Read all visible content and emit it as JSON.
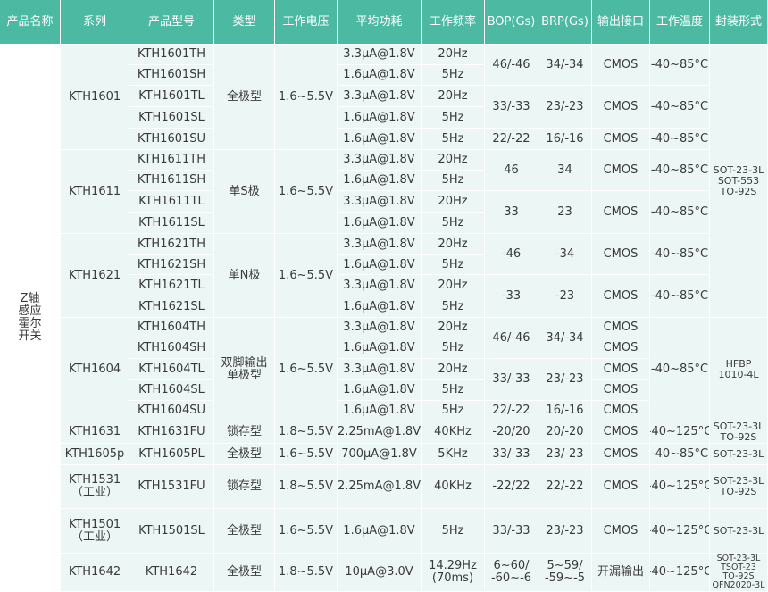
{
  "colors": {
    "header_bg": "#4cbaa3",
    "row_bg": "#ecf6f4",
    "line": "#ffffff",
    "text": "#3a3a3a"
  },
  "headers": [
    "产品名称",
    "系列",
    "产品型号",
    "类型",
    "工作电压",
    "平均功耗",
    "工作频率",
    "BOP(Gs)",
    "BRP(Gs)",
    "输出接口",
    "工作温度",
    "封装形式"
  ],
  "product_name": "Z轴\n感应\n霍尔\n开关",
  "cells": [
    {
      "r": 0,
      "c": 1,
      "rs": 5,
      "t": "KTH1601"
    },
    {
      "r": 0,
      "c": 2,
      "t": "KTH1601TH"
    },
    {
      "r": 1,
      "c": 2,
      "t": "KTH1601SH"
    },
    {
      "r": 2,
      "c": 2,
      "t": "KTH1601TL"
    },
    {
      "r": 3,
      "c": 2,
      "t": "KTH1601SL"
    },
    {
      "r": 4,
      "c": 2,
      "t": "KTH1601SU"
    },
    {
      "r": 0,
      "c": 3,
      "rs": 5,
      "t": "全极型"
    },
    {
      "r": 0,
      "c": 4,
      "rs": 5,
      "t": "1.6~5.5V"
    },
    {
      "r": 0,
      "c": 5,
      "t": "3.3μA@1.8V"
    },
    {
      "r": 1,
      "c": 5,
      "t": "1.6μA@1.8V"
    },
    {
      "r": 2,
      "c": 5,
      "t": "3.3μA@1.8V"
    },
    {
      "r": 3,
      "c": 5,
      "t": "1.6μA@1.8V"
    },
    {
      "r": 4,
      "c": 5,
      "t": "1.6μA@1.8V"
    },
    {
      "r": 0,
      "c": 6,
      "t": "20Hz"
    },
    {
      "r": 1,
      "c": 6,
      "t": "5Hz"
    },
    {
      "r": 2,
      "c": 6,
      "t": "20Hz"
    },
    {
      "r": 3,
      "c": 6,
      "t": "5Hz"
    },
    {
      "r": 4,
      "c": 6,
      "t": "5Hz"
    },
    {
      "r": 0,
      "c": 7,
      "rs": 2,
      "t": "46/-46"
    },
    {
      "r": 2,
      "c": 7,
      "rs": 2,
      "t": "33/-33"
    },
    {
      "r": 4,
      "c": 7,
      "t": "22/-22"
    },
    {
      "r": 0,
      "c": 8,
      "rs": 2,
      "t": "34/-34"
    },
    {
      "r": 2,
      "c": 8,
      "rs": 2,
      "t": "23/-23"
    },
    {
      "r": 4,
      "c": 8,
      "t": "16/-16"
    },
    {
      "r": 0,
      "c": 9,
      "rs": 2,
      "t": "CMOS"
    },
    {
      "r": 2,
      "c": 9,
      "rs": 2,
      "t": "CMOS"
    },
    {
      "r": 4,
      "c": 9,
      "t": "CMOS"
    },
    {
      "r": 0,
      "c": 10,
      "rs": 2,
      "t": "-40~85°C"
    },
    {
      "r": 2,
      "c": 10,
      "rs": 2,
      "t": "-40~85°C"
    },
    {
      "r": 4,
      "c": 10,
      "t": "-40~85°C"
    },
    {
      "r": 5,
      "c": 1,
      "rs": 4,
      "t": "KTH1611"
    },
    {
      "r": 5,
      "c": 2,
      "t": "KTH1611TH"
    },
    {
      "r": 6,
      "c": 2,
      "t": "KTH1611SH"
    },
    {
      "r": 7,
      "c": 2,
      "t": "KTH1611TL"
    },
    {
      "r": 8,
      "c": 2,
      "t": "KTH1611SL"
    },
    {
      "r": 5,
      "c": 3,
      "rs": 4,
      "t": "单S极"
    },
    {
      "r": 5,
      "c": 4,
      "rs": 4,
      "t": "1.6~5.5V"
    },
    {
      "r": 5,
      "c": 5,
      "t": "3.3μA@1.8V"
    },
    {
      "r": 6,
      "c": 5,
      "t": "1.6μA@1.8V"
    },
    {
      "r": 7,
      "c": 5,
      "t": "3.3μA@1.8V"
    },
    {
      "r": 8,
      "c": 5,
      "t": "1.6μA@1.8V"
    },
    {
      "r": 5,
      "c": 6,
      "t": "20Hz"
    },
    {
      "r": 6,
      "c": 6,
      "t": "5Hz"
    },
    {
      "r": 7,
      "c": 6,
      "t": "20Hz"
    },
    {
      "r": 8,
      "c": 6,
      "t": "5Hz"
    },
    {
      "r": 5,
      "c": 7,
      "rs": 2,
      "t": "46"
    },
    {
      "r": 7,
      "c": 7,
      "rs": 2,
      "t": "33"
    },
    {
      "r": 5,
      "c": 8,
      "rs": 2,
      "t": "34"
    },
    {
      "r": 7,
      "c": 8,
      "rs": 2,
      "t": "23"
    },
    {
      "r": 5,
      "c": 9,
      "rs": 2,
      "t": "CMOS"
    },
    {
      "r": 7,
      "c": 9,
      "rs": 2,
      "t": "CMOS"
    },
    {
      "r": 5,
      "c": 10,
      "rs": 2,
      "t": "-40~85°C"
    },
    {
      "r": 7,
      "c": 10,
      "rs": 2,
      "t": "-40~85°C"
    },
    {
      "r": 9,
      "c": 1,
      "rs": 4,
      "t": "KTH1621"
    },
    {
      "r": 9,
      "c": 2,
      "t": "KTH1621TH"
    },
    {
      "r": 10,
      "c": 2,
      "t": "KTH1621SH"
    },
    {
      "r": 11,
      "c": 2,
      "t": "KTH1621TL"
    },
    {
      "r": 12,
      "c": 2,
      "t": "KTH1621SL"
    },
    {
      "r": 9,
      "c": 3,
      "rs": 4,
      "t": "单N极"
    },
    {
      "r": 9,
      "c": 4,
      "rs": 4,
      "t": "1.6~5.5V"
    },
    {
      "r": 9,
      "c": 5,
      "t": "3.3μA@1.8V"
    },
    {
      "r": 10,
      "c": 5,
      "t": "1.6μA@1.8V"
    },
    {
      "r": 11,
      "c": 5,
      "t": "3.3μA@1.8V"
    },
    {
      "r": 12,
      "c": 5,
      "t": "1.6μA@1.8V"
    },
    {
      "r": 9,
      "c": 6,
      "t": "20Hz"
    },
    {
      "r": 10,
      "c": 6,
      "t": "5Hz"
    },
    {
      "r": 11,
      "c": 6,
      "t": "20Hz"
    },
    {
      "r": 12,
      "c": 6,
      "t": "5Hz"
    },
    {
      "r": 9,
      "c": 7,
      "rs": 2,
      "t": "-46"
    },
    {
      "r": 11,
      "c": 7,
      "rs": 2,
      "t": "-33"
    },
    {
      "r": 9,
      "c": 8,
      "rs": 2,
      "t": "-34"
    },
    {
      "r": 11,
      "c": 8,
      "rs": 2,
      "t": "-23"
    },
    {
      "r": 9,
      "c": 9,
      "rs": 2,
      "t": "CMOS"
    },
    {
      "r": 11,
      "c": 9,
      "rs": 2,
      "t": "CMOS"
    },
    {
      "r": 9,
      "c": 10,
      "rs": 2,
      "t": "-40~85°C"
    },
    {
      "r": 11,
      "c": 10,
      "rs": 2,
      "t": "-40~85°C"
    },
    {
      "r": 0,
      "c": 11,
      "rs": 13,
      "t": "SOT-23-3L\nSOT-553\nTO-92S",
      "cls": "c-small"
    },
    {
      "r": 13,
      "c": 1,
      "rs": 5,
      "t": "KTH1604"
    },
    {
      "r": 13,
      "c": 2,
      "t": "KTH1604TH"
    },
    {
      "r": 14,
      "c": 2,
      "t": "KTH1604SH"
    },
    {
      "r": 15,
      "c": 2,
      "t": "KTH1604TL"
    },
    {
      "r": 16,
      "c": 2,
      "t": "KTH1604SL"
    },
    {
      "r": 17,
      "c": 2,
      "t": "KTH1604SU"
    },
    {
      "r": 13,
      "c": 3,
      "rs": 5,
      "t": "双脚输出\n单极型"
    },
    {
      "r": 13,
      "c": 4,
      "rs": 5,
      "t": "1.6~5.5V"
    },
    {
      "r": 13,
      "c": 5,
      "t": "3.3μA@1.8V"
    },
    {
      "r": 14,
      "c": 5,
      "t": "1.6μA@1.8V"
    },
    {
      "r": 15,
      "c": 5,
      "t": "3.3μA@1.8V"
    },
    {
      "r": 16,
      "c": 5,
      "t": "1.6μA@1.8V"
    },
    {
      "r": 17,
      "c": 5,
      "t": "1.6μA@1.8V"
    },
    {
      "r": 13,
      "c": 6,
      "t": "20Hz"
    },
    {
      "r": 14,
      "c": 6,
      "t": "5Hz"
    },
    {
      "r": 15,
      "c": 6,
      "t": "20Hz"
    },
    {
      "r": 16,
      "c": 6,
      "t": "5Hz"
    },
    {
      "r": 17,
      "c": 6,
      "t": "5Hz"
    },
    {
      "r": 13,
      "c": 7,
      "rs": 2,
      "t": "46/-46"
    },
    {
      "r": 15,
      "c": 7,
      "rs": 2,
      "t": "33/-33"
    },
    {
      "r": 17,
      "c": 7,
      "t": "22/-22"
    },
    {
      "r": 13,
      "c": 8,
      "rs": 2,
      "t": "34/-34"
    },
    {
      "r": 15,
      "c": 8,
      "rs": 2,
      "t": "23/-23"
    },
    {
      "r": 17,
      "c": 8,
      "t": "16/-16"
    },
    {
      "r": 13,
      "c": 9,
      "t": "CMOS"
    },
    {
      "r": 14,
      "c": 9,
      "t": "CMOS"
    },
    {
      "r": 15,
      "c": 9,
      "t": "CMOS"
    },
    {
      "r": 16,
      "c": 9,
      "t": "CMOS"
    },
    {
      "r": 17,
      "c": 9,
      "t": "CMOS"
    },
    {
      "r": 13,
      "c": 10,
      "rs": 5,
      "t": "-40~85°C"
    },
    {
      "r": 13,
      "c": 11,
      "rs": 5,
      "t": "HFBP\n1010-4L",
      "cls": "c-small"
    },
    {
      "r": 18,
      "c": 1,
      "t": "KTH1631"
    },
    {
      "r": 18,
      "c": 2,
      "t": "KTH1631FU"
    },
    {
      "r": 18,
      "c": 3,
      "t": "锁存型"
    },
    {
      "r": 18,
      "c": 4,
      "t": "1.8~5.5V"
    },
    {
      "r": 18,
      "c": 5,
      "t": "2.25mA@1.8V"
    },
    {
      "r": 18,
      "c": 6,
      "t": "40KHz"
    },
    {
      "r": 18,
      "c": 7,
      "t": "-20/20"
    },
    {
      "r": 18,
      "c": 8,
      "t": "20/-20"
    },
    {
      "r": 18,
      "c": 9,
      "t": "CMOS"
    },
    {
      "r": 18,
      "c": 10,
      "t": "-40~125°C"
    },
    {
      "r": 18,
      "c": 11,
      "t": "SOT-23-3L\nTO-92S",
      "cls": "c-small"
    },
    {
      "r": 19,
      "c": 1,
      "t": "KTH1605p"
    },
    {
      "r": 19,
      "c": 2,
      "t": "KTH1605PL"
    },
    {
      "r": 19,
      "c": 3,
      "t": "全极型"
    },
    {
      "r": 19,
      "c": 4,
      "t": "1.6~5.5V"
    },
    {
      "r": 19,
      "c": 5,
      "t": "700μA@1.8V"
    },
    {
      "r": 19,
      "c": 6,
      "t": "5KHz"
    },
    {
      "r": 19,
      "c": 7,
      "t": "33/-33"
    },
    {
      "r": 19,
      "c": 8,
      "t": "23/-23"
    },
    {
      "r": 19,
      "c": 9,
      "t": "CMOS"
    },
    {
      "r": 19,
      "c": 10,
      "t": "-40~85°C"
    },
    {
      "r": 19,
      "c": 11,
      "t": "SOT-23-3L",
      "cls": "c-small"
    },
    {
      "r": 20,
      "c": 1,
      "t": "KTH1531\n（工业）"
    },
    {
      "r": 20,
      "c": 2,
      "t": "KTH1531FU"
    },
    {
      "r": 20,
      "c": 3,
      "t": "锁存型"
    },
    {
      "r": 20,
      "c": 4,
      "t": "1.8~5.5V"
    },
    {
      "r": 20,
      "c": 5,
      "t": "2.25mA@1.8V"
    },
    {
      "r": 20,
      "c": 6,
      "t": "40KHz"
    },
    {
      "r": 20,
      "c": 7,
      "t": "-22/22"
    },
    {
      "r": 20,
      "c": 8,
      "t": "22/-22"
    },
    {
      "r": 20,
      "c": 9,
      "t": "CMOS"
    },
    {
      "r": 20,
      "c": 10,
      "t": "-40~125°C"
    },
    {
      "r": 20,
      "c": 11,
      "t": "SOT-23-3L\nTO-92S",
      "cls": "c-small"
    },
    {
      "r": 21,
      "c": 1,
      "t": "KTH1501\n（工业）"
    },
    {
      "r": 21,
      "c": 2,
      "t": "KTH1501SL"
    },
    {
      "r": 21,
      "c": 3,
      "t": "全极型"
    },
    {
      "r": 21,
      "c": 4,
      "t": "1.6~5.5V"
    },
    {
      "r": 21,
      "c": 5,
      "t": "1.6μA@1.8V"
    },
    {
      "r": 21,
      "c": 6,
      "t": "5Hz"
    },
    {
      "r": 21,
      "c": 7,
      "t": "33/-33"
    },
    {
      "r": 21,
      "c": 8,
      "t": "23/-23"
    },
    {
      "r": 21,
      "c": 9,
      "t": "CMOS"
    },
    {
      "r": 21,
      "c": 10,
      "t": "-40~125°C"
    },
    {
      "r": 21,
      "c": 11,
      "t": "SOT-23-3L",
      "cls": "c-small"
    },
    {
      "r": 22,
      "c": 1,
      "t": "KTH1642"
    },
    {
      "r": 22,
      "c": 2,
      "t": "KTH1642"
    },
    {
      "r": 22,
      "c": 3,
      "t": "全极型"
    },
    {
      "r": 22,
      "c": 4,
      "t": "1.8~5.5V"
    },
    {
      "r": 22,
      "c": 5,
      "t": "10μA@3.0V"
    },
    {
      "r": 22,
      "c": 6,
      "t": "14.29Hz\n(70ms)"
    },
    {
      "r": 22,
      "c": 7,
      "t": "6~60/\n-60~-6"
    },
    {
      "r": 22,
      "c": 8,
      "t": "5~59/\n-59~-5"
    },
    {
      "r": 22,
      "c": 9,
      "t": "开漏输出"
    },
    {
      "r": 22,
      "c": 10,
      "t": "-40~125°C"
    },
    {
      "r": 22,
      "c": 11,
      "t": "SOT-23-3L\nTSOT-23\nTO-92S\nQFN2020-3L",
      "cls": "c-tiny"
    }
  ]
}
